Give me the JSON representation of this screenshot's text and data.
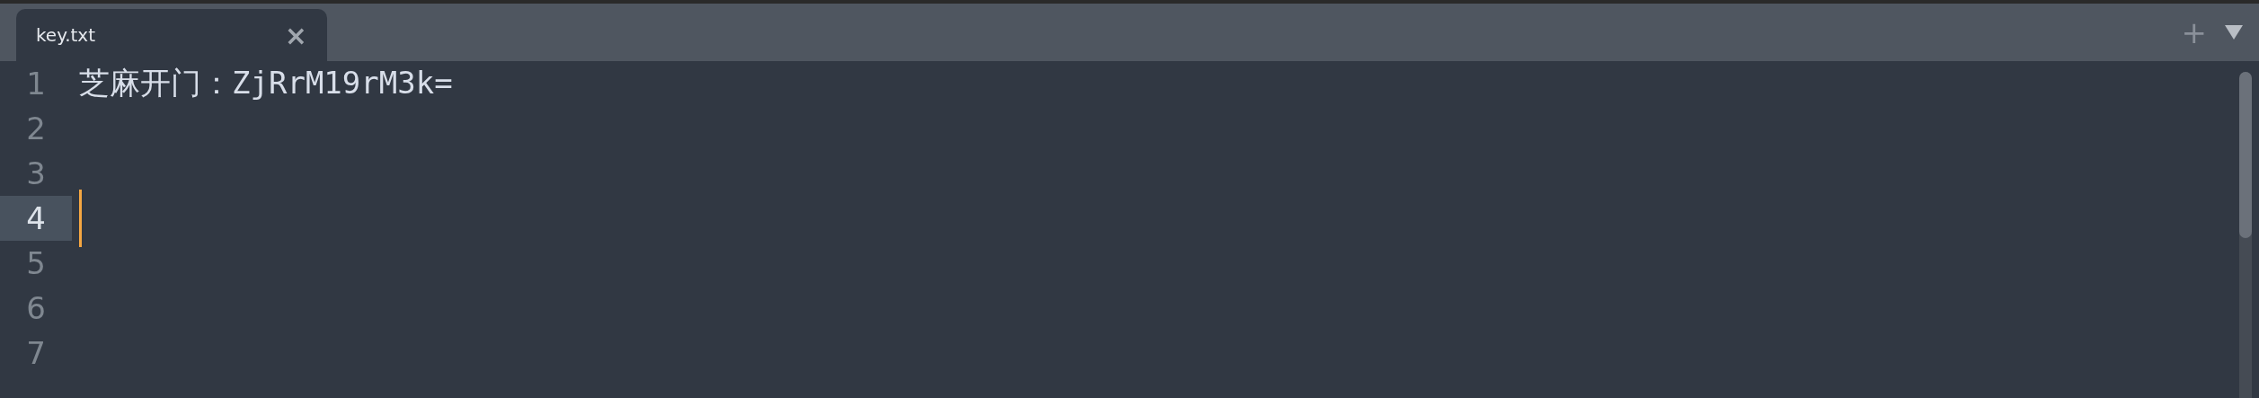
{
  "tabs": [
    {
      "label": "key.txt",
      "selected": true,
      "close": "×"
    }
  ],
  "tab_bar_actions": {
    "new_tab": "+"
  },
  "editor": {
    "lines": [
      {
        "number": "1",
        "text": "芝麻开门：ZjRrM19rM3k=",
        "current": false
      },
      {
        "number": "2",
        "current": false
      },
      {
        "number": "3",
        "current": false
      },
      {
        "number": "4",
        "current": true
      },
      {
        "number": "5",
        "current": false
      },
      {
        "number": "6",
        "current": false
      },
      {
        "number": "7",
        "current": false
      }
    ]
  }
}
